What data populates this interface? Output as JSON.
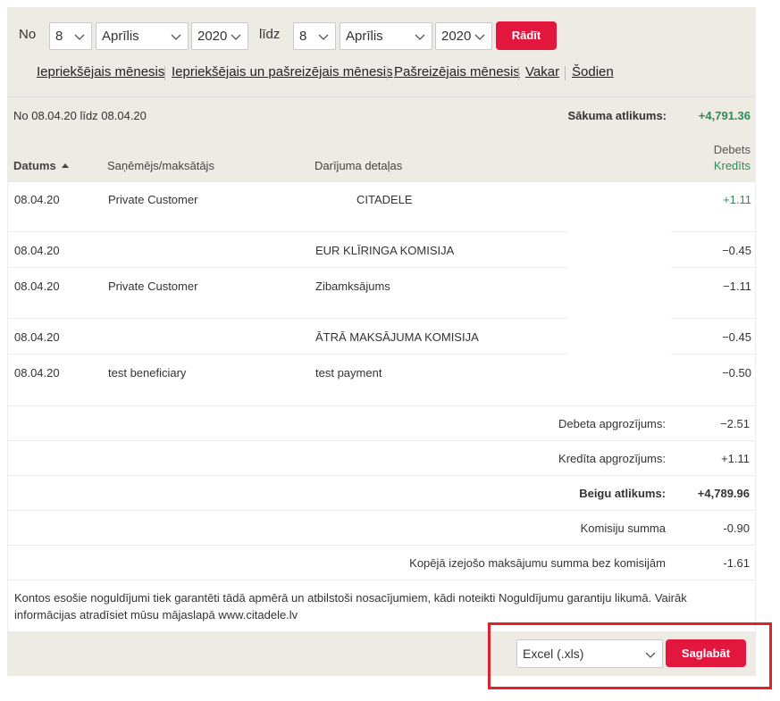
{
  "filter": {
    "from_label": "No",
    "from_day": "8",
    "from_month": "Aprīlis",
    "from_year": "2020",
    "to_label": "līdz",
    "to_day": "8",
    "to_month": "Aprīlis",
    "to_year": "2020",
    "show_button": "Rādīt",
    "quick_links": [
      "Iepriekšējais mēnesis",
      "Iepriekšējais un pašreizējais mēnesis",
      "Pašreizējais mēnesis",
      "Vakar",
      "Šodien"
    ]
  },
  "statement": {
    "period": "No 08.04.20 līdz 08.04.20",
    "opening_label": "Sākuma atlikums:",
    "opening_value": "+4,791.36",
    "debit_header": "Debets",
    "credit_header": "Kredīts",
    "columns": {
      "date": "Datums",
      "party": "Saņēmējs/maksātājs",
      "details": "Darījuma detaļas"
    },
    "transactions": [
      {
        "date": "08.04.20",
        "party": "Private Customer",
        "details": "CITADELE",
        "amount": "+1.11"
      },
      {
        "date": "08.04.20",
        "party": "",
        "details": "EUR KLĪRINGA KOMISIJA",
        "amount": "−0.45"
      },
      {
        "date": "08.04.20",
        "party": "Private Customer",
        "details": "Zibamksājums",
        "amount": "−1.11"
      },
      {
        "date": "08.04.20",
        "party": "",
        "details": "ĀTRĀ MAKSĀJUMA KOMISIJA",
        "amount": "−0.45"
      },
      {
        "date": "08.04.20",
        "party": "test beneficiary",
        "details": "test payment",
        "amount": "−0.50"
      }
    ],
    "summary": [
      {
        "label": "Debeta apgrozījums:",
        "value": "−2.51"
      },
      {
        "label": "Kredīta apgrozījums:",
        "value": "+1.11"
      },
      {
        "label": "Beigu atlikums:",
        "value": "+4,789.96"
      },
      {
        "label": "Komisiju summa",
        "value": "-0.90"
      },
      {
        "label": "Kopējā izejošo maksājumu summa bez komisijām",
        "value": "-1.61"
      }
    ],
    "note": "Kontos esošie noguldījumi tiek garantēti tādā apmērā un atbilstoši nosacījumiem, kādi noteikti Noguldījumu garantiju likumā. Vairāk informācijas atradīsiet mūsu mājaslapā www.citadele.lv"
  },
  "export": {
    "format": "Excel (.xls)",
    "save_button": "Saglabāt"
  },
  "colors": {
    "accent": "#e3173e",
    "positive": "#2e8b57",
    "panel_bg": "#eeeae4",
    "highlight": "#e0202a"
  }
}
